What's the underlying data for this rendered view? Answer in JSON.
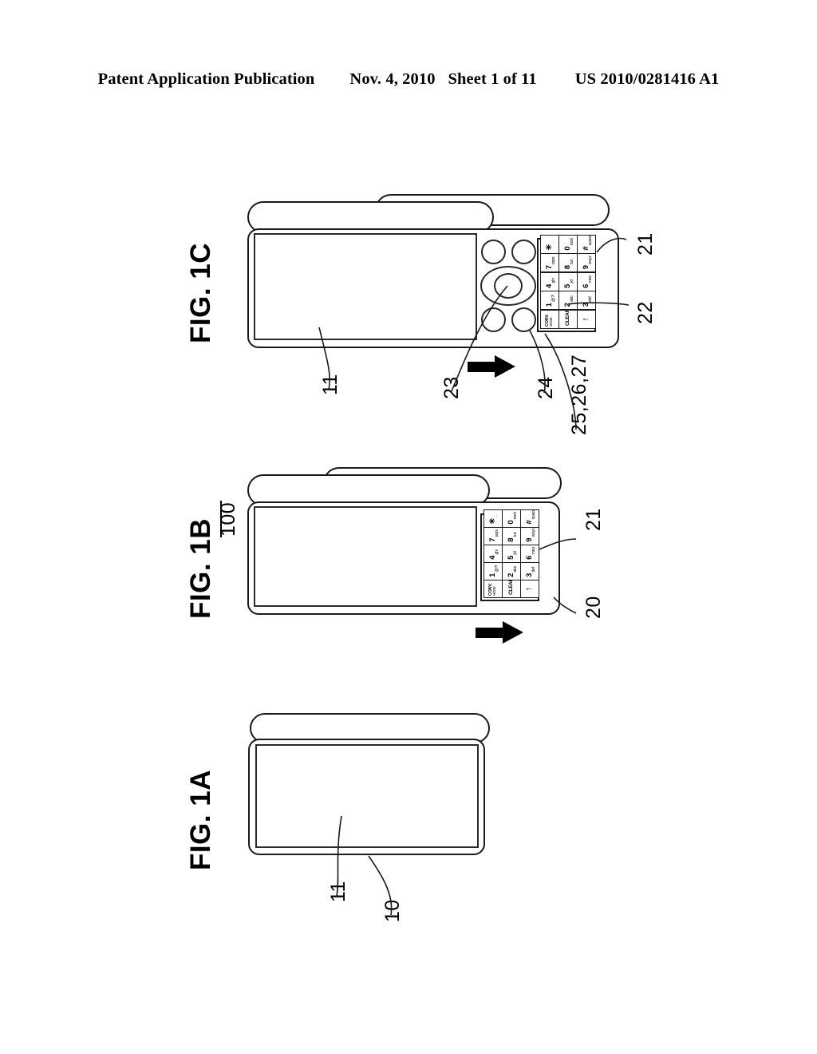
{
  "header": {
    "publication": "Patent Application Publication",
    "date": "Nov. 4, 2010",
    "sheet": "Sheet 1 of 11",
    "doc_number": "US 2010/0281416 A1"
  },
  "figures": {
    "fig_a": {
      "label": "FIG. 1A",
      "refs": {
        "display": "11",
        "body": "10"
      }
    },
    "fig_b": {
      "label": "FIG. 1B",
      "refs": {
        "assembly": "100",
        "keypad": "21",
        "lower_unit": "20"
      }
    },
    "fig_c": {
      "label": "FIG. 1C",
      "refs": {
        "display": "11",
        "keypad": "21",
        "key_group": "22",
        "center_key": "23",
        "side_key": "24",
        "multi": "25,26,27"
      }
    }
  },
  "keypad": {
    "columns": [
      {
        "keys": [
          {
            "main": "CONV.",
            "sub": "MODE",
            "type": "fn2"
          },
          {
            "main": "CLEAR",
            "sub": "",
            "type": "fn"
          },
          {
            "main": "↑",
            "sub": "",
            "type": "glyph"
          }
        ]
      },
      {
        "keys": [
          {
            "main": "1",
            "sub": "@?!",
            "type": "num"
          },
          {
            "main": "2",
            "sub": "abc",
            "type": "num"
          },
          {
            "main": "3",
            "sub": "def",
            "type": "num"
          }
        ]
      },
      {
        "keys": [
          {
            "main": "4",
            "sub": "ghi",
            "type": "num"
          },
          {
            "main": "5",
            "sub": "jkl",
            "type": "num"
          },
          {
            "main": "6",
            "sub": "mno",
            "type": "num"
          }
        ]
      },
      {
        "keys": [
          {
            "main": "7",
            "sub": "pqrs",
            "type": "num"
          },
          {
            "main": "8",
            "sub": "tuv",
            "type": "num"
          },
          {
            "main": "9",
            "sub": "wxyz",
            "type": "num"
          }
        ]
      },
      {
        "keys": [
          {
            "main": "✳",
            "sub": "·",
            "type": "num"
          },
          {
            "main": "0",
            "sub": "next",
            "type": "num"
          },
          {
            "main": "#",
            "sub": "space",
            "type": "num"
          }
        ]
      }
    ]
  },
  "arrows": {
    "glyph_name": "right-arrow"
  }
}
